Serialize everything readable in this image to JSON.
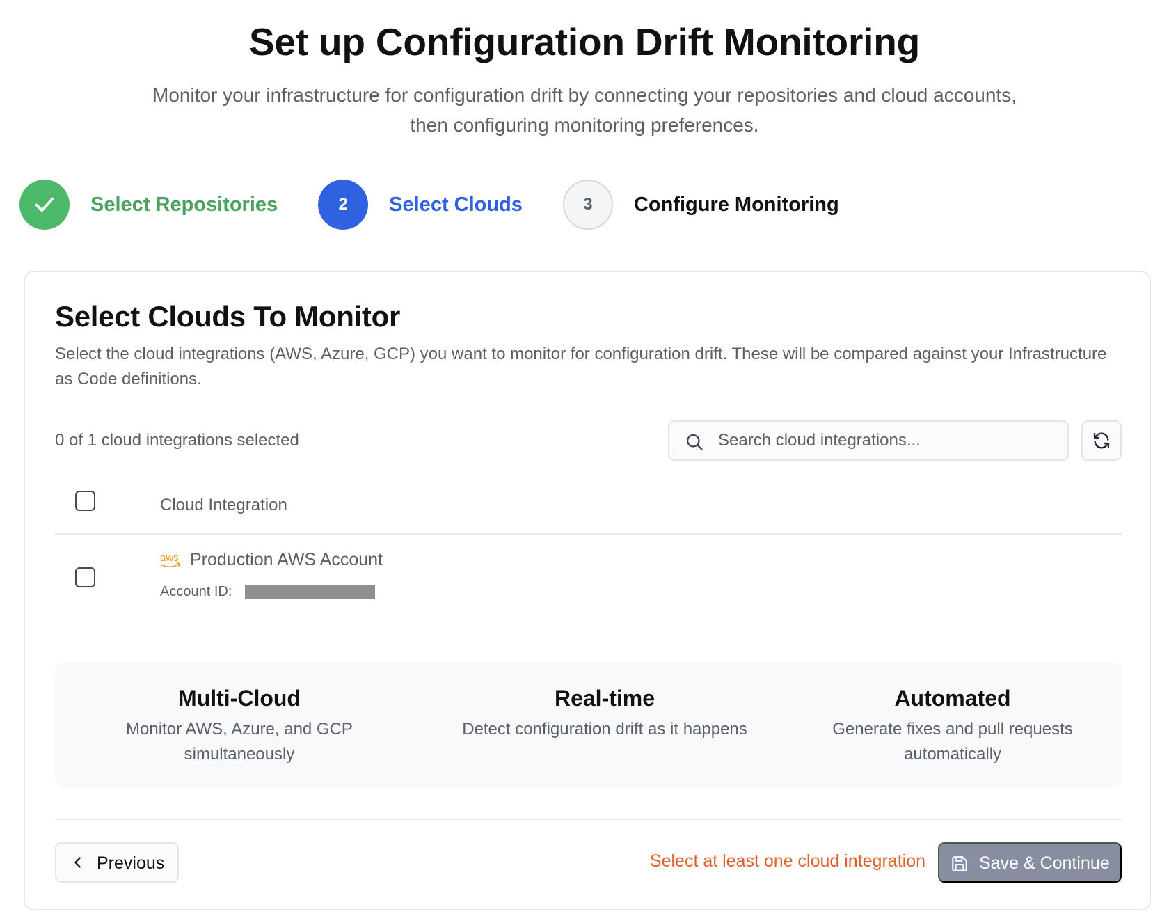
{
  "header": {
    "title": "Set up Configuration Drift Monitoring",
    "subtitle_line1": "Monitor your infrastructure for configuration drift by connecting your repositories and cloud accounts,",
    "subtitle_line2": "then configuring monitoring preferences."
  },
  "stepper": {
    "steps": [
      {
        "label": "Select Repositories",
        "status": "complete",
        "icon": "check-icon"
      },
      {
        "number": "2",
        "label": "Select Clouds",
        "status": "active"
      },
      {
        "number": "3",
        "label": "Configure Monitoring",
        "status": "pending"
      }
    ]
  },
  "card": {
    "title": "Select Clouds To Monitor",
    "description": "Select the cloud integrations (AWS, Azure, GCP) you want to monitor for configuration drift. These will be compared against your Infrastructure as Code definitions.",
    "selected_count": "0 of 1 cloud integrations selected",
    "search": {
      "placeholder": "Search cloud integrations...",
      "value": ""
    },
    "table": {
      "header": "Cloud Integration",
      "rows": [
        {
          "provider_logo": "aws",
          "name": "Production AWS Account",
          "account_label": "Account ID:",
          "account_id_redacted": true,
          "selected": false
        }
      ]
    },
    "features": [
      {
        "title": "Multi-Cloud",
        "description": "Monitor AWS, Azure, and GCP simultaneously"
      },
      {
        "title": "Real-time",
        "description": "Detect configuration drift as it happens"
      },
      {
        "title": "Automated",
        "description": "Generate fixes and pull requests automatically"
      }
    ],
    "footer": {
      "previous_label": "Previous",
      "validation_message": "Select at least one cloud integration",
      "save_label": "Save & Continue"
    }
  },
  "colors": {
    "complete": "#4cb86a",
    "active": "#2f62e0",
    "warning": "#e0622a",
    "disabled_button": "#878ea0",
    "aws_orange": "#f29a26"
  }
}
